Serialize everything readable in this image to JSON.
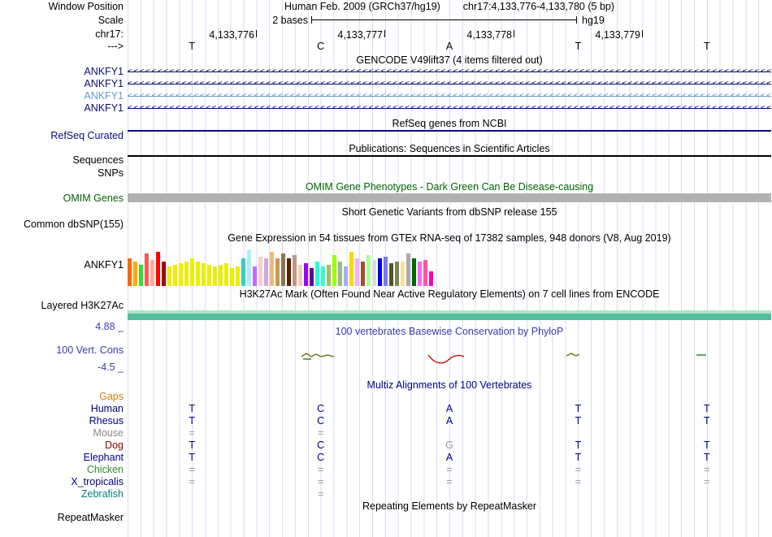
{
  "header": {
    "window_position_label": "Window Position",
    "title_assembly": "Human Feb. 2009 (GRCh37/hg19)",
    "title_range": "chr17:4,133,776-4,133,780 (5 bp)",
    "scale_label": "Scale",
    "scale_value": "2 bases",
    "scale_genome": "hg19",
    "chrom_label": "chr17:",
    "coords": [
      "4,133,776",
      "4,133,777",
      "4,133,778",
      "4,133,779"
    ],
    "strand_label": "--->",
    "bases": [
      "T",
      "C",
      "A",
      "T",
      "T"
    ]
  },
  "grid": {
    "line_color": "#D8DFF2"
  },
  "tracks": {
    "gencode": {
      "title": "GENCODE V49lift37 (4 items filtered out)",
      "genes": [
        {
          "label": "ANKFY1",
          "color": "#0C0C78"
        },
        {
          "label": "ANKFY1",
          "color": "#0C0C78"
        },
        {
          "label": "ANKFY1",
          "color": "#6699CC"
        },
        {
          "label": "ANKFY1",
          "color": "#0C0C78"
        }
      ]
    },
    "refseq": {
      "title": "RefSeq genes from NCBI",
      "label": "RefSeq Curated",
      "color": "#0C0C78"
    },
    "publications": {
      "title": "Publications: Sequences in Scientific Articles",
      "sequences_label": "Sequences",
      "snps_label": "SNPs",
      "item_color": "#000000"
    },
    "omim": {
      "title": "OMIM Gene Phenotypes - Dark Green Can Be Disease-causing",
      "title_color": "#006400",
      "label": "OMIM Genes",
      "label_color": "#006400",
      "bar_color": "#B2B2B2"
    },
    "dbsnp": {
      "title": "Short Genetic Variants from dbSNP release 155",
      "label": "Common dbSNP(155)"
    },
    "gtex": {
      "title": "Gene Expression in 54 tissues from GTEx RNA-seq of 17382 samples, 948 donors (V8, Aug 2019)",
      "label": "ANKFY1",
      "bars": [
        {
          "c": "#FF6600",
          "h": 34
        },
        {
          "c": "#FFAA00",
          "h": 30
        },
        {
          "c": "#33DD33",
          "h": 26
        },
        {
          "c": "#FF5555",
          "h": 40
        },
        {
          "c": "#FFAA99",
          "h": 32
        },
        {
          "c": "#FF0000",
          "h": 42
        },
        {
          "c": "#AA0000",
          "h": 30
        },
        {
          "c": "#EEEE00",
          "h": 24
        },
        {
          "c": "#EEEE00",
          "h": 26
        },
        {
          "c": "#EEEE00",
          "h": 28
        },
        {
          "c": "#EEEE00",
          "h": 30
        },
        {
          "c": "#EEEE00",
          "h": 34
        },
        {
          "c": "#EEEE00",
          "h": 30
        },
        {
          "c": "#EEEE00",
          "h": 28
        },
        {
          "c": "#EEEE00",
          "h": 26
        },
        {
          "c": "#EEEE00",
          "h": 24
        },
        {
          "c": "#EEEE00",
          "h": 26
        },
        {
          "c": "#EEEE00",
          "h": 28
        },
        {
          "c": "#EEEE00",
          "h": 22
        },
        {
          "c": "#EEEE00",
          "h": 24
        },
        {
          "c": "#33CCCC",
          "h": 34
        },
        {
          "c": "#AAEEFF",
          "h": 44
        },
        {
          "c": "#CC66FF",
          "h": 24
        },
        {
          "c": "#FFCCCC",
          "h": 36
        },
        {
          "c": "#CCAADD",
          "h": 34
        },
        {
          "c": "#EEBB77",
          "h": 42
        },
        {
          "c": "#CC9955",
          "h": 34
        },
        {
          "c": "#8B7355",
          "h": 40
        },
        {
          "c": "#552200",
          "h": 34
        },
        {
          "c": "#BB9988",
          "h": 38
        },
        {
          "c": "#EECCBB",
          "h": 26
        },
        {
          "c": "#9900FF",
          "h": 28
        },
        {
          "c": "#660099",
          "h": 22
        },
        {
          "c": "#22FFDD",
          "h": 30
        },
        {
          "c": "#33FFCC",
          "h": 24
        },
        {
          "c": "#AABB66",
          "h": 26
        },
        {
          "c": "#99FF00",
          "h": 38
        },
        {
          "c": "#99BB88",
          "h": 30
        },
        {
          "c": "#AAAAFF",
          "h": 24
        },
        {
          "c": "#FFD700",
          "h": 42
        },
        {
          "c": "#FFAAFF",
          "h": 34
        },
        {
          "c": "#995522",
          "h": 30
        },
        {
          "c": "#AAFF99",
          "h": 38
        },
        {
          "c": "#DDDDDD",
          "h": 32
        },
        {
          "c": "#0000FF",
          "h": 34
        },
        {
          "c": "#7777FF",
          "h": 36
        },
        {
          "c": "#555522",
          "h": 28
        },
        {
          "c": "#778855",
          "h": 30
        },
        {
          "c": "#FFDD99",
          "h": 30
        },
        {
          "c": "#AAAAAA",
          "h": 40
        },
        {
          "c": "#006600",
          "h": 34
        },
        {
          "c": "#FF66FF",
          "h": 30
        },
        {
          "c": "#FF5599",
          "h": 32
        },
        {
          "c": "#FF00BB",
          "h": 18
        }
      ]
    },
    "h3k27ac": {
      "title": "H3K27Ac Mark (Often Found Near Active Regulatory Elements) on 7 cell lines from ENCODE",
      "label": "Layered H3K27Ac",
      "top_color": "#ADE8C5",
      "main_color": "#52BE9B"
    },
    "phylop": {
      "title": "100 vertebrates Basewise Conservation by PhyloP",
      "label": "100 Vert. Cons",
      "max_label": "4.88 _",
      "min_label": "-4.5 _",
      "color": "#3B3BAF",
      "pos_mark_color": "#7A7A1E",
      "neg_mark_color": "#C00000",
      "green_mark_color": "#2E8B2E"
    },
    "multiz": {
      "title": "Multiz Alignments of 100 Vertebrates",
      "title_color": "#00008B",
      "gaps_label": "Gaps",
      "gaps_color": "#C8820A",
      "rows": [
        {
          "name": "Human",
          "name_color": "#00008B",
          "letter_color": "#00008B",
          "cells": [
            "T",
            "C",
            "A",
            "T",
            "T"
          ]
        },
        {
          "name": "Rhesus",
          "name_color": "#00008B",
          "letter_color": "#00008B",
          "cells": [
            "T",
            "C",
            "A",
            "T",
            "T"
          ]
        },
        {
          "name": "Mouse",
          "name_color": "#8A8A8A",
          "letter_color": "#9A9A9A",
          "cells": [
            "=",
            "=",
            "",
            "",
            ""
          ]
        },
        {
          "name": "Dog",
          "name_color": "#8B0000",
          "letter_color": "#00008B",
          "cells": [
            "T",
            "C",
            {
              "t": "G",
              "c": "#9A9A9A"
            },
            "T",
            "T"
          ]
        },
        {
          "name": "Elephant",
          "name_color": "#00008B",
          "letter_color": "#00008B",
          "cells": [
            "T",
            "C",
            "A",
            "T",
            "T"
          ]
        },
        {
          "name": "Chicken",
          "name_color": "#2E8B2E",
          "letter_color": "#9A9A9A",
          "cells": [
            "=",
            "=",
            "=",
            "=",
            "="
          ]
        },
        {
          "name": "X_tropicalis",
          "name_color": "#00008B",
          "letter_color": "#9A9A9A",
          "cells": [
            "=",
            "=",
            "=",
            "=",
            "="
          ]
        },
        {
          "name": "Zebrafish",
          "name_color": "#008080",
          "letter_color": "#9A9A9A",
          "cells": [
            "",
            "=",
            "",
            "",
            ""
          ]
        }
      ]
    },
    "repeatmasker": {
      "title": "Repeating Elements by RepeatMasker",
      "label": "RepeatMasker"
    }
  }
}
